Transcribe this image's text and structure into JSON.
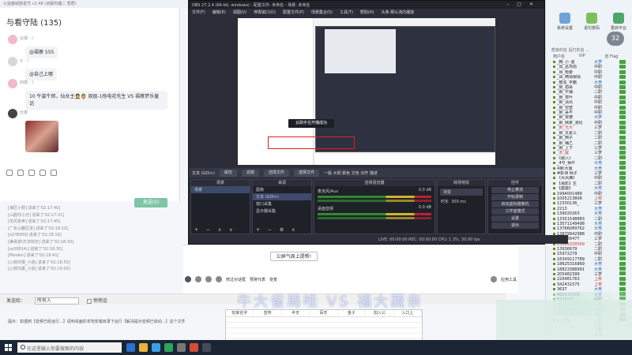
{
  "bg_app": {
    "title": "公益鹿城慈善节 v2.48 (旧服务器二 帮帮)"
  },
  "chat": {
    "title": "与看守陆 (135)",
    "messages": [
      {
        "nick": "云端 ·   ♪",
        "text": "@福蔡 555"
      },
      {
        "nick": "◎  ·  ♪",
        "text": "@自己上哪"
      },
      {
        "nick": "四楼  ·   ♪",
        "text": "10 午姿牛郎，仙女主🤵👰 周姐-1拖电花先生 VS 福蔡梦乐童话"
      },
      {
        "nick": "云端",
        "text": ""
      }
    ],
    "send_label": "发送(S)"
  },
  "log": [
    "[海区小规] 进来了'02:17:40]",
    "[山庭均小分] 进来了'02:17:21]",
    "[花风雀卖] 进来了'02:17:45]",
    "[广东山雅区安] 进来了'02:18:10]",
    "[ɑ1ª8000] 进来了'02:18:16]",
    "[兼得]的方法刻无] 进来了'02:18:30]",
    "[sc08D(A)] 进来了'02:18:30]",
    "[Maiden] 进来了'02:18:41]",
    "[心结均振_小泉] 进来了'02:18:50]",
    "[心结均振_小泉] 进来了'02:19:00]"
  ],
  "broadcast": {
    "label": "发送给：",
    "target": "所有人",
    "check_label": "悄悄话"
  },
  "notice": "提示：如遇到【音频已经运行...】请到桌面的本地安装目录下运行【解决提示音频已启动...】这个文件",
  "sheet": {
    "columns": [
      "玩家名字",
      "宣传",
      "半天",
      "百天",
      "金子",
      "加入公",
      "入口上"
    ]
  },
  "taskbar": {
    "search_placeholder": "在这里输入你要搜索的内容"
  },
  "right_panel": {
    "buttons": [
      "系统设置",
      "语句复码",
      "重启平台"
    ],
    "count": "32",
    "tabs": "帮家的名  后打的名  ...",
    "header": [
      "用户名",
      "VIP",
      "自 Flag"
    ],
    "users": [
      "_韩_小_强",
      "_出_总点局",
      "_出_哈要",
      "_出_两场舅情",
      "_暗冻_宇霸",
      "_默_拍哥",
      "_默_牛抽",
      "_默_草叶",
      "_默_清风",
      "_默_空壁",
      "_默_哥不",
      "_默_安德",
      "_默_晴家_测化",
      "_默_光大",
      "_默_文素三",
      "_默_西子",
      "_默_梅乙",
      "_默_上下",
      "_本_醒",
      "《朋入》",
      "_4号_柄牛",
      "4家i大姐",
      "#影诗 柄子",
      "《大风满》",
      "【翡影】生",
      "【震旋】",
      "1994001489",
      "1005213806",
      "12330136_",
      "2213",
      "139020263",
      "13351548883",
      "13571149498",
      "13766089762",
      "13879942988",
      "139026477",
      "13893258569",
      "13936679",
      "15972279",
      "16349117789",
      "18625316869",
      "18823388991",
      "205482399",
      "220481763",
      "342431575",
      "3637",
      "452033069",
      "5228161",
      "5336208",
      "7956119",
      "a1355034008",
      "a_Lmy"
    ],
    "roles": [
      "大梦",
      "中尉",
      "中尉",
      "中尉",
      "大竞",
      "中尉",
      "二尉",
      "中尉",
      "中尉",
      "中尉",
      "中尉",
      "大梦",
      "中尉",
      "三梦",
      "二尉",
      "二尉",
      "二尉",
      "三梦",
      "三梦",
      "二尉",
      "大竞",
      "大竞",
      "三梦",
      "中尉",
      "二尉",
      "大竞",
      "中尉",
      "上校",
      "三梦",
      "大竞",
      "大竞",
      "二尉",
      "大竞",
      "大竞",
      "中尉",
      "三梦",
      "二尉",
      "二尉",
      "中尉",
      "二尉",
      "大竞",
      "大竞",
      "三梦",
      "上校",
      "上校",
      "大竞",
      "大竞",
      "中尉",
      "二尉",
      "中尉",
      "中尉",
      "二尉",
      "上校",
      "三梦",
      "大竞"
    ]
  },
  "obs": {
    "title": "OBS 27.2.4 (64-bit, windows) - 配置文件: 未命名 - 场景: 未命名",
    "menu": [
      "文件(F)",
      "编辑(E)",
      "视图(V)",
      "停靠窗口(D)",
      "配置文件(P)",
      "场景集合(S)",
      "工具(T)",
      "帮助(H)",
      "头条·那么流向播放"
    ],
    "preview_banner": "云助手在开播成功",
    "ctrl": {
      "text_label": "文本 (GDI+)",
      "props": "属性",
      "filters": "滤镜",
      "choose_file": "选择文件",
      "choose_file2": "选择文件",
      "hint": "一般 大铜 颜色 文色 对齐 描述"
    },
    "docks": {
      "scenes": {
        "title": "场景",
        "items": [
          "场景"
        ],
        "foot": "+ − ∧ ∨"
      },
      "sources": {
        "title": "来源",
        "items": [
          "图像",
          "文本 (GDI+)",
          "窗口采集",
          "显示器采集"
        ],
        "foot": "+ − ⚙ ∧ ∨"
      },
      "mixer": {
        "title": "音频混音器",
        "rows": [
          "麦克风/Aux",
          "桌面音频"
        ],
        "db1": "0.0 dB",
        "db2": "0.0 dB"
      },
      "transitions": {
        "title": "转场特效",
        "type": "渐变",
        "duration_label": "时长",
        "duration": "300 ms"
      },
      "controls": {
        "title": "控件",
        "buttons": [
          "停止推流",
          "开始录制",
          "启动虚拟摄像机",
          "工作室模式",
          "设置",
          "退出"
        ]
      }
    },
    "status": "LIVE: 00:00:00  REC: 00:00:00  CPU: 1.3%, 30.00 fps"
  },
  "chat_input": {
    "live_button": "公屏气周上提帮!",
    "tools": [
      "修过对话框",
      "预排代表",
      "变麦"
    ],
    "record_label": "应用工具"
  },
  "watermark": "牛大雀局哇 VS 福大蔬亲"
}
